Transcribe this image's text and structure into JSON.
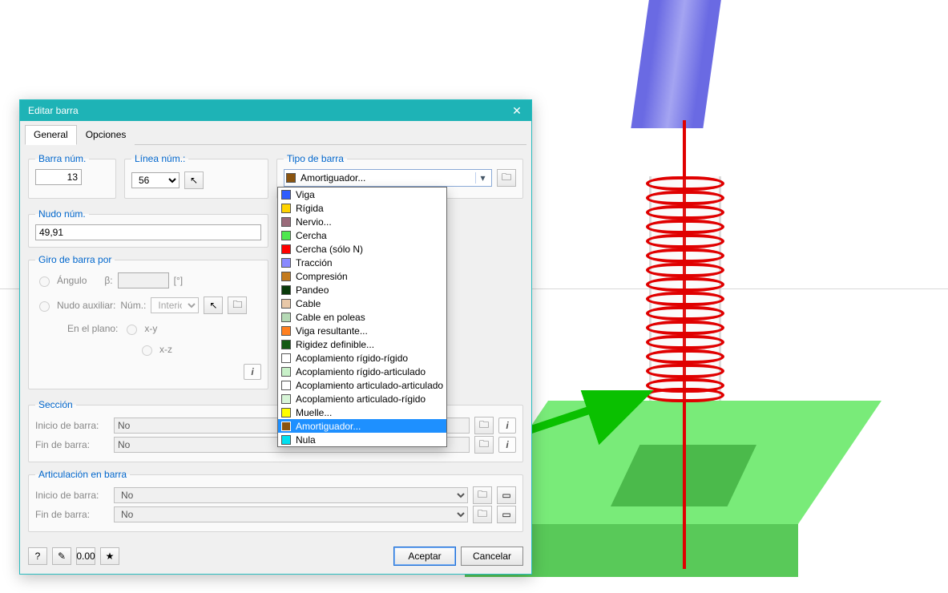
{
  "window": {
    "title": "Editar barra",
    "close_glyph": "✕"
  },
  "tabs": [
    "General",
    "Opciones"
  ],
  "active_tab": 0,
  "groups": {
    "barra_num": {
      "legend": "Barra núm.",
      "value": "13"
    },
    "linea_num": {
      "legend": "Línea núm.:",
      "value": "56"
    },
    "tipo_barra": {
      "legend": "Tipo de barra",
      "selected": "Amortiguador...",
      "selected_color": "#8a5410"
    },
    "nudo_num": {
      "legend": "Nudo núm.",
      "value": "49,91"
    },
    "giro": {
      "legend": "Giro de barra por",
      "angle_label": "Ángulo",
      "beta_label": "β:",
      "beta_unit": "[°]",
      "aux_label": "Nudo auxiliar:",
      "num_label": "Núm.:",
      "num_value": "Interior",
      "plane_label": "En el plano:",
      "plane_xy": "x-y",
      "plane_xz": "x-z"
    },
    "seccion": {
      "legend": "Sección",
      "start_label": "Inicio de barra:",
      "start_value": "No",
      "end_label": "Fin de barra:",
      "end_value": "No"
    },
    "artic": {
      "legend": "Articulación en barra",
      "start_label": "Inicio de barra:",
      "start_value": "No",
      "end_label": "Fin de barra:",
      "end_value": "No"
    }
  },
  "type_options": [
    {
      "label": "Viga",
      "color": "#2f5cff"
    },
    {
      "label": "Rígida",
      "color": "#ffd400"
    },
    {
      "label": "Nervio...",
      "color": "#9a6b7a"
    },
    {
      "label": "Cercha",
      "color": "#4fe84f"
    },
    {
      "label": "Cercha (sólo N)",
      "color": "#ff0000"
    },
    {
      "label": "Tracción",
      "color": "#8a8aff"
    },
    {
      "label": "Compresión",
      "color": "#c47b1e"
    },
    {
      "label": "Pandeo",
      "color": "#0a3a0a"
    },
    {
      "label": "Cable",
      "color": "#e8c8a8"
    },
    {
      "label": "Cable en poleas",
      "color": "#b5d9b5"
    },
    {
      "label": "Viga resultante...",
      "color": "#ff7f1f"
    },
    {
      "label": "Rigidez definible...",
      "color": "#145a14"
    },
    {
      "label": "Acoplamiento rígido-rígido",
      "color": "#ffffff"
    },
    {
      "label": "Acoplamiento rígido-articulado",
      "color": "#c8f0c8"
    },
    {
      "label": "Acoplamiento articulado-articulado",
      "color": "#ffffff"
    },
    {
      "label": "Acoplamiento articulado-rígido",
      "color": "#d7f5d7"
    },
    {
      "label": "Muelle...",
      "color": "#ffff00"
    },
    {
      "label": "Amortiguador...",
      "color": "#8a5410",
      "selected": true
    },
    {
      "label": "Nula",
      "color": "#00e0f0"
    }
  ],
  "buttons": {
    "ok": "Aceptar",
    "cancel": "Cancelar"
  },
  "icons": {
    "pick": "↖",
    "library": "▭",
    "folder": "🗀",
    "info": "i",
    "help": "?",
    "edit": "✎",
    "units": "0.00",
    "favorite": "★"
  }
}
